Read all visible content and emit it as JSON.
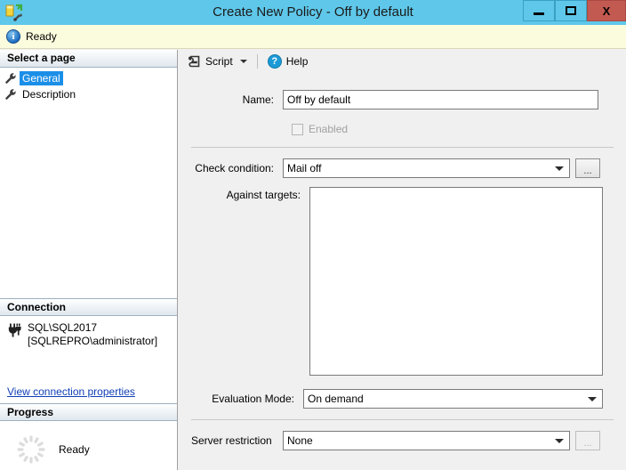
{
  "titlebar": {
    "title": "Create New Policy - Off by default",
    "icon": "policy-condition-icon",
    "minimize_label": "",
    "maximize_label": "",
    "close_label": "X"
  },
  "infobar": {
    "icon": "info-icon",
    "glyph": "i",
    "text": "Ready"
  },
  "sidebar": {
    "select_page_header": "Select a page",
    "pages": [
      {
        "label": "General",
        "icon": "wrench-icon",
        "selected": true
      },
      {
        "label": "Description",
        "icon": "wrench-icon",
        "selected": false
      }
    ],
    "connection_header": "Connection",
    "connection": {
      "icon": "plug-icon",
      "server": "SQL\\SQL2017",
      "user": "[SQLREPRO\\administrator]",
      "link": "View connection properties"
    },
    "progress_header": "Progress",
    "progress": {
      "icon": "spinner-icon",
      "status": "Ready"
    }
  },
  "toolbar": {
    "script_label": "Script",
    "script_icon": "script-icon",
    "dropdown_icon": "chevron-down-icon",
    "help_label": "Help",
    "help_icon": "help-question-icon",
    "help_glyph": "?"
  },
  "form": {
    "name_label": "Name:",
    "name_value": "Off by default",
    "enabled_label": "Enabled",
    "enabled_checked": false,
    "check_condition_label": "Check condition:",
    "check_condition_value": "Mail off",
    "check_condition_browse": "...",
    "against_targets_label": "Against targets:",
    "against_targets_items": [],
    "evaluation_mode_label": "Evaluation Mode:",
    "evaluation_mode_value": "On demand",
    "server_restriction_label": "Server restriction",
    "server_restriction_value": "None",
    "server_restriction_browse": "..."
  },
  "colors": {
    "titlebar": "#5fc8ea",
    "close_button": "#c35a51",
    "selection": "#1b8fe8",
    "infobar": "#fbfbdd",
    "panel": "#f0f0f0",
    "link": "#0f3fb5"
  }
}
